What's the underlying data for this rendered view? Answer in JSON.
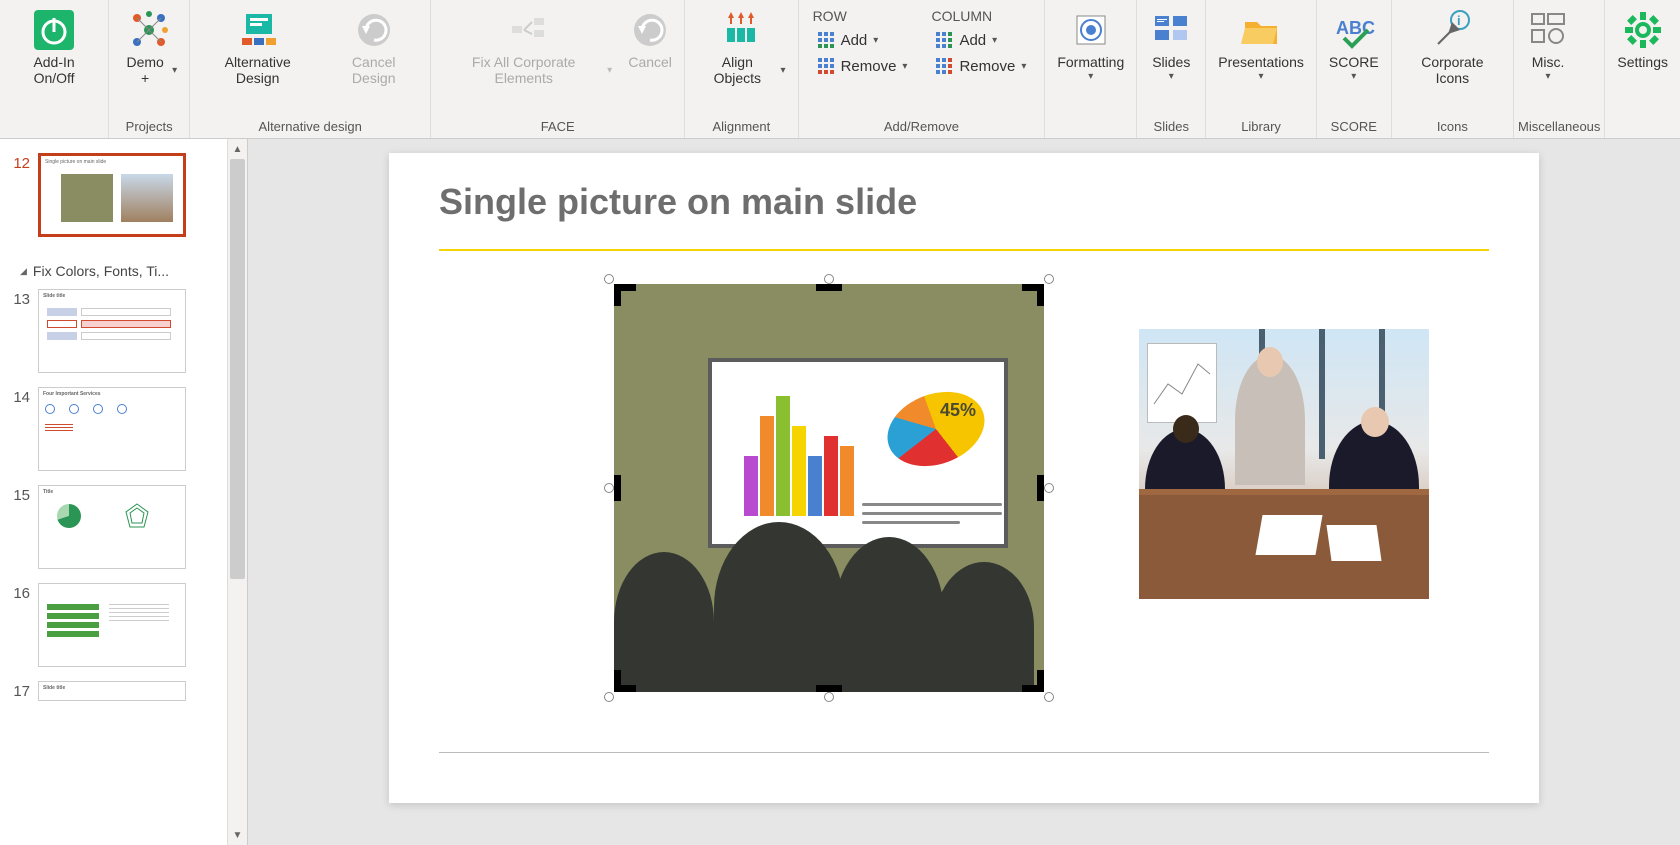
{
  "ribbon": {
    "addin": {
      "label": "Add-In On/Off"
    },
    "demo": {
      "label": "Demo +"
    },
    "projects_group": "Projects",
    "alt_design": {
      "label": "Alternative Design"
    },
    "cancel_design": {
      "label": "Cancel Design"
    },
    "alt_design_group": "Alternative design",
    "fix_corp": {
      "label": "Fix All Corporate Elements"
    },
    "cancel_face": {
      "label": "Cancel"
    },
    "face_group": "FACE",
    "align": {
      "label": "Align Objects"
    },
    "align_group": "Alignment",
    "row_label": "ROW",
    "col_label": "COLUMN",
    "add_btn": "Add",
    "remove_btn": "Remove",
    "addremove_group": "Add/Remove",
    "formatting": {
      "label": "Formatting"
    },
    "slides": {
      "label": "Slides"
    },
    "slides_group": "Slides",
    "presentations": {
      "label": "Presentations"
    },
    "library_group": "Library",
    "score": {
      "label": "SCORE"
    },
    "score_group": "SCORE",
    "corp_icons": {
      "label": "Corporate Icons"
    },
    "icons_group": "Icons",
    "misc": {
      "label": "Misc."
    },
    "misc_group": "Miscellaneous",
    "settings": {
      "label": "Settings"
    }
  },
  "thumbnails": {
    "section_title": "Fix Colors, Fonts, Ti...",
    "items": [
      {
        "num": "12",
        "title": "Single picture on main slide",
        "active": true
      },
      {
        "num": "13",
        "title": "Slide title"
      },
      {
        "num": "14",
        "title": "Four Important Services"
      },
      {
        "num": "15",
        "title": "Title"
      },
      {
        "num": "16",
        "title": ""
      },
      {
        "num": "17",
        "title": "Slide title"
      }
    ]
  },
  "slide": {
    "title": "Single picture on main slide",
    "pie_label": "45%"
  }
}
